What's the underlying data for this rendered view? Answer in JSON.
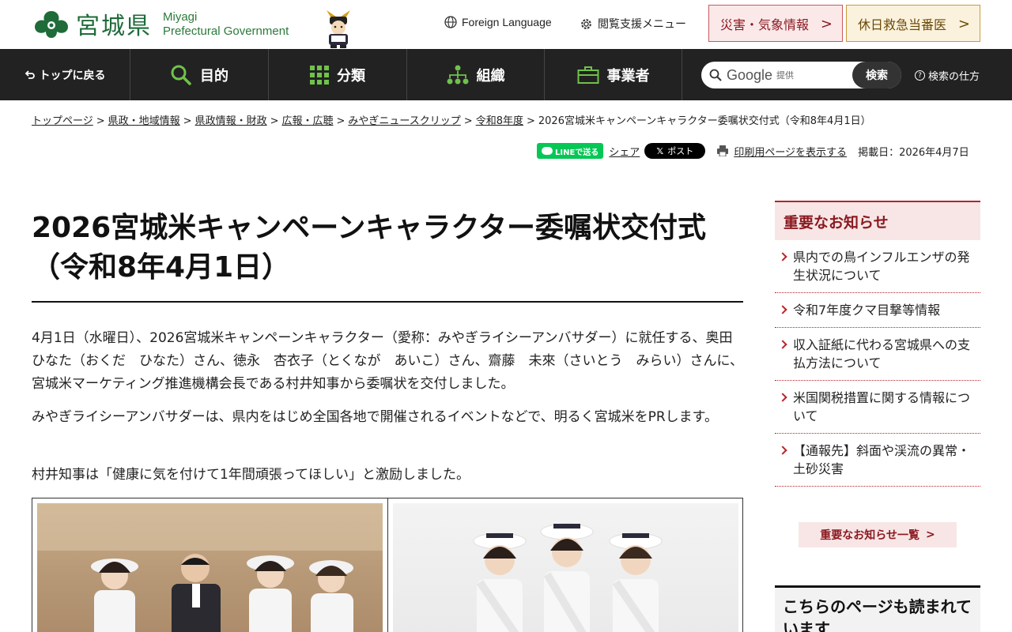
{
  "header": {
    "logo_ja": "宮城県",
    "logo_en_line1": "Miyagi",
    "logo_en_line2": "Prefectural Government",
    "foreign_language": "Foreign Language",
    "accessibility_menu": "閲覧支援メニュー",
    "disaster_button": "災害・気象情報",
    "holiday_button": "休日救急当番医"
  },
  "nav": {
    "back_to_top": "トップに戻る",
    "purpose": "目的",
    "category": "分類",
    "organization": "組織",
    "business": "事業者",
    "search_brand": "Google",
    "search_brand_sub": "提供",
    "search_button": "検索",
    "search_help": "検索の仕方"
  },
  "breadcrumb": {
    "items": [
      "トップページ",
      "県政・地域情報",
      "県政情報・財政",
      "広報・広聴",
      "みやぎニュースクリップ",
      "令和8年度"
    ],
    "current": "2026宮城米キャンペーンキャラクター委嘱状交付式（令和8年4月1日）"
  },
  "share": {
    "line": "LINEで送る",
    "share": "シェア",
    "x_post": "ポスト",
    "print": "印刷用ページを表示する",
    "posted": "掲載日：2026年4月7日"
  },
  "article": {
    "title": "2026宮城米キャンペーンキャラクター委嘱状交付式（令和8年4月1日）",
    "paragraphs": [
      "4月1日（水曜日）、2026宮城米キャンペーンキャラクター（愛称：みやぎライシーアンバサダー）に就任する、奥田　ひなた（おくだ　ひなた）さん、徳永　杏衣子（とくなが　あいこ）さん、齋藤　未來（さいとう　みらい）さんに、宮城米マーケティング推進機構会長である村井知事から委嘱状を交付しました。",
      "みやぎライシーアンバサダーは、県内をはじめ全国各地で開催されるイベントなどで、明るく宮城米をPRします。",
      "村井知事は「健康に気を付けて1年間頑張ってほしい」と激励しました。"
    ]
  },
  "sidebar": {
    "notice_title": "重要なお知らせ",
    "notices": [
      "県内での鳥インフルエンザの発生状況について",
      "令和7年度クマ目撃等情報",
      "収入証紙に代わる宮城県への支払方法について",
      "米国関税措置に関する情報について",
      "【通報先】斜面や渓流の異常・土砂災害"
    ],
    "notice_all": "重要なお知らせ一覧",
    "also_read": "こちらのページも読まれています"
  },
  "colors": {
    "brand_green": "#1f6b3a",
    "nav_bg": "#222222",
    "alert_red": "#b6242a",
    "line_green": "#06c755"
  }
}
